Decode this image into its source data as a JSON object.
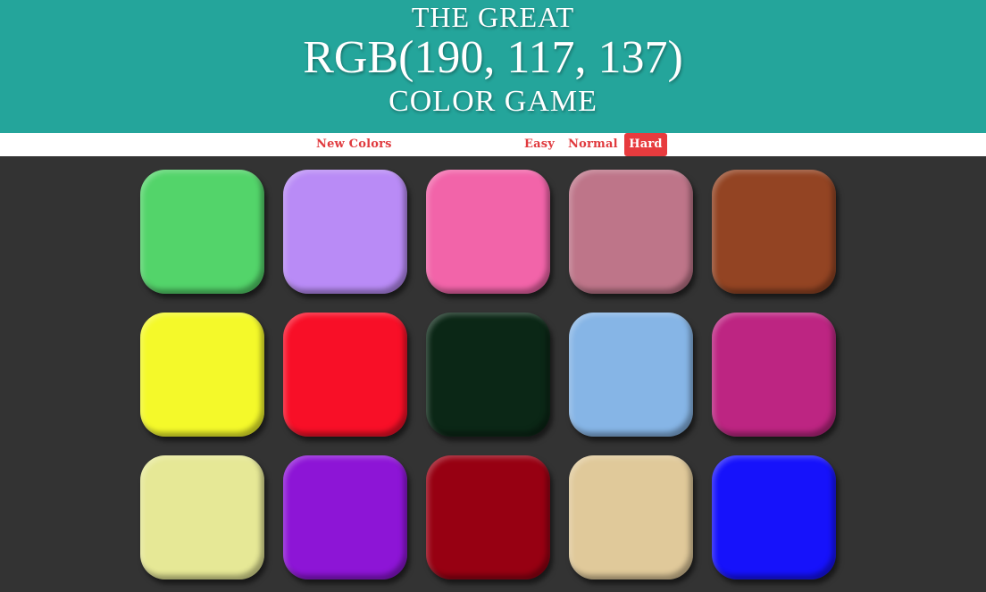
{
  "header": {
    "title_top": "The Great",
    "rgb_display": "RGB(190, 117, 137)",
    "title_bottom": "Color Game",
    "background_color": "#24a59b"
  },
  "stripe": {
    "new_colors_label": "New Colors",
    "modes": [
      {
        "label": "Easy",
        "selected": false
      },
      {
        "label": "Normal",
        "selected": false
      },
      {
        "label": "Hard",
        "selected": true
      }
    ],
    "accent_color": "#e73b3e"
  },
  "board": {
    "background_color": "#333333",
    "squares": [
      {
        "color": "#53d46a"
      },
      {
        "color": "#b98bf6"
      },
      {
        "color": "#f264a9"
      },
      {
        "color": "#be7589"
      },
      {
        "color": "#934423"
      },
      {
        "color": "#f4f92a"
      },
      {
        "color": "#f80f27"
      },
      {
        "color": "#0b2716"
      },
      {
        "color": "#86b5e6"
      },
      {
        "color": "#bd2582"
      },
      {
        "color": "#e6e896"
      },
      {
        "color": "#8d15d6"
      },
      {
        "color": "#970012"
      },
      {
        "color": "#e0c99a"
      },
      {
        "color": "#1612fb"
      }
    ]
  }
}
